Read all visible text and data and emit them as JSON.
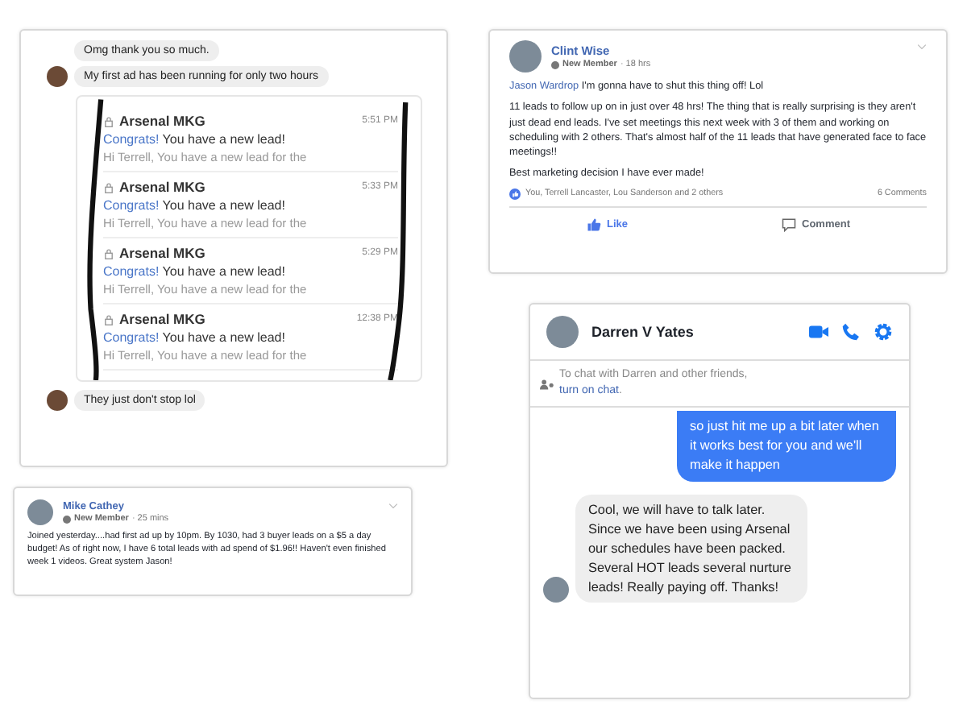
{
  "chat_thread": {
    "messages_top": [
      {
        "text": "Omg thank you so much.",
        "avatar": false
      },
      {
        "text": "My first ad has been running for only two hours",
        "avatar": true
      }
    ],
    "notifications": [
      {
        "sender": "Arsenal MKG",
        "time": "5:51 PM",
        "highlight": "Congrats!",
        "subject": "You have a new lead!",
        "preview": "Hi Terrell, You have a new lead for the"
      },
      {
        "sender": "Arsenal MKG",
        "time": "5:33 PM",
        "highlight": "Congrats!",
        "subject": "You have a new lead!",
        "preview": "Hi Terrell, You have a new lead for the"
      },
      {
        "sender": "Arsenal MKG",
        "time": "5:29 PM",
        "highlight": "Congrats!",
        "subject": "You have a new lead!",
        "preview": "Hi Terrell, You have a new lead for the"
      },
      {
        "sender": "Arsenal MKG",
        "time": "12:38 PM",
        "highlight": "Congrats!",
        "subject": "You have a new lead!",
        "preview": "Hi Terrell, You have a new lead for the"
      }
    ],
    "messages_bottom": [
      {
        "text": "They just don't stop lol",
        "avatar": true
      }
    ]
  },
  "post_clint": {
    "author": "Clint Wise",
    "badge": "New Member",
    "time": "· 18 hrs",
    "mention": "Jason Wardrop",
    "first_line": "I'm gonna have to shut this thing off! Lol",
    "paragraphs": [
      "11 leads to follow up on in just over 48 hrs! The thing that is really surprising is they aren't just dead end leads. I've set meetings this next week with 3 of them and working on scheduling with 2 others. That's almost half of the 11 leads that have generated face to face meetings!!",
      "Best marketing decision I have ever made!"
    ],
    "reactions": "You, Terrell Lancaster, Lou Sanderson and 2 others",
    "comments": "6 Comments",
    "actions": [
      {
        "label": "Like",
        "kind": "like"
      },
      {
        "label": "Comment",
        "kind": "comment"
      }
    ]
  },
  "post_mike": {
    "author": "Mike Cathey",
    "badge": "New Member",
    "time": "· 25 mins",
    "text": "Joined yesterday....had first ad up by 10pm. By 1030, had 3 buyer leads on a $5 a day budget! As of right now, I have 6 total leads with ad spend of $1.96!! Haven't even finished week 1 videos. Great system Jason!"
  },
  "messenger": {
    "name": "Darren V Yates",
    "notice": "To chat with Darren and other friends,",
    "notice_link": "turn on chat",
    "notice_end": ".",
    "messages": [
      {
        "text": "so just hit me up a bit later when it works best for you and we'll make it happen",
        "outgoing": true
      },
      {
        "text": "Cool, we will have to talk later. Since we have been using Arsenal our schedules have been packed. Several HOT leads several nurture leads! Really paying off. Thanks!",
        "outgoing": false
      }
    ]
  }
}
